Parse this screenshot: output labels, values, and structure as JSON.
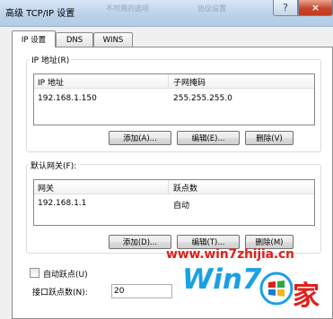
{
  "window": {
    "title": "高级 TCP/IP 设置",
    "background_text": [
      "不可用的选项",
      "协议设置"
    ],
    "help_glyph": "?",
    "close_glyph": "×"
  },
  "tabs": [
    {
      "label": "IP 设置",
      "active": true
    },
    {
      "label": "DNS",
      "active": false
    },
    {
      "label": "WINS",
      "active": false
    }
  ],
  "ip_group": {
    "title": "IP 地址(R)",
    "columns": [
      "IP 地址",
      "子网掩码"
    ],
    "rows": [
      {
        "ip": "192.168.1.150",
        "mask": "255.255.255.0"
      }
    ],
    "buttons": {
      "add": "添加(A)...",
      "edit": "编辑(E)...",
      "delete": "删除(V)"
    }
  },
  "gateway_group": {
    "title": "默认网关(F):",
    "columns": [
      "网关",
      "跃点数"
    ],
    "rows": [
      {
        "gateway": "192.168.1.1",
        "metric": "自动"
      }
    ],
    "buttons": {
      "add": "添加(D)...",
      "edit": "编辑(T)...",
      "delete": "删除(M)"
    }
  },
  "auto_metric": {
    "label": "自动跃点(U)",
    "checked": false
  },
  "interface_metric": {
    "label": "接口跃点数(N):",
    "value": "20"
  },
  "watermark": {
    "site": "www.win7zhijia.cn",
    "brand": "Win7",
    "char": "家"
  },
  "colors": {
    "accent_red": "#e0201a",
    "accent_blue": "#1aa0e6"
  }
}
